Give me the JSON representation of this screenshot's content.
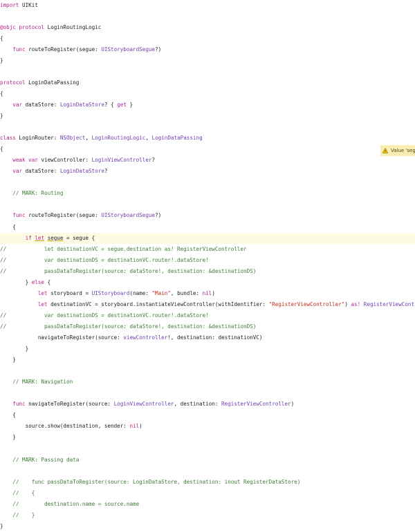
{
  "colors": {
    "background": "#ffffff",
    "keyword": "#b0238f",
    "type": "#6e3fb0",
    "comment": "#3f7d36",
    "string": "#c42a1b",
    "plain": "#1d1d1d",
    "current_line_highlight": "#fdfbe3",
    "warning_badge": "#f7edb5"
  },
  "warning": {
    "icon": "warning-triangle-icon",
    "text": "Value 'seg"
  },
  "code_lines": [
    [
      [
        "k",
        "import"
      ],
      [
        "p",
        " UIKit"
      ]
    ],
    [],
    [
      [
        "k",
        "@objc protocol"
      ],
      [
        "p",
        " LoginRoutingLogic"
      ]
    ],
    [
      [
        "p",
        "{"
      ]
    ],
    [
      [
        "k",
        "    func"
      ],
      [
        "p",
        " routeToRegister(segue: "
      ],
      [
        "t",
        "UIStoryboardSegue"
      ],
      [
        "p",
        "?)"
      ]
    ],
    [
      [
        "p",
        "}"
      ]
    ],
    [],
    [
      [
        "k",
        "protocol"
      ],
      [
        "p",
        " LoginDataPassing"
      ]
    ],
    [
      [
        "p",
        "{"
      ]
    ],
    [
      [
        "k",
        "    var"
      ],
      [
        "p",
        " dataStore: "
      ],
      [
        "t",
        "LoginDataStore"
      ],
      [
        "p",
        "? { "
      ],
      [
        "k",
        "get"
      ],
      [
        "p",
        " }"
      ]
    ],
    [
      [
        "p",
        "}"
      ]
    ],
    [],
    [
      [
        "k",
        "class"
      ],
      [
        "p",
        " LoginRouter: "
      ],
      [
        "t",
        "NSObject"
      ],
      [
        "p",
        ", "
      ],
      [
        "t",
        "LoginRoutingLogic"
      ],
      [
        "p",
        ", "
      ],
      [
        "t",
        "LoginDataPassing"
      ]
    ],
    [
      [
        "p",
        "{"
      ]
    ],
    [
      [
        "k",
        "    weak var"
      ],
      [
        "p",
        " viewController: "
      ],
      [
        "t",
        "LoginViewController"
      ],
      [
        "p",
        "?"
      ]
    ],
    [
      [
        "k",
        "    var"
      ],
      [
        "p",
        " dataStore: "
      ],
      [
        "t",
        "LoginDataStore"
      ],
      [
        "p",
        "?"
      ]
    ],
    [],
    [
      [
        "c",
        "    // MARK: Routing"
      ]
    ],
    [],
    [
      [
        "k",
        "    func"
      ],
      [
        "p",
        " routeToRegister(segue: "
      ],
      [
        "t",
        "UIStoryboardSegue"
      ],
      [
        "p",
        "?)"
      ]
    ],
    [
      [
        "p",
        "    {"
      ]
    ],
    [
      [
        "k",
        "        if "
      ],
      [
        "ku",
        "let"
      ],
      [
        "p",
        " "
      ],
      [
        "pu",
        "segue"
      ],
      [
        "p",
        " = segue {"
      ]
    ],
    [
      [
        "c",
        "//            let destinationVC = segue.destination as! RegisterViewController"
      ]
    ],
    [
      [
        "c",
        "//            var destinationDS = destinationVC.router!.dataStore!"
      ]
    ],
    [
      [
        "c",
        "//            passDataToRegister(source: dataStore!, destination: &destinationDS)"
      ]
    ],
    [
      [
        "p",
        "        } "
      ],
      [
        "k",
        "else"
      ],
      [
        "p",
        " {"
      ]
    ],
    [
      [
        "k",
        "            let"
      ],
      [
        "p",
        " storyboard = "
      ],
      [
        "t",
        "UIStoryboard"
      ],
      [
        "p",
        "(name: "
      ],
      [
        "s",
        "\"Main\""
      ],
      [
        "p",
        ", bundle: "
      ],
      [
        "k",
        "nil"
      ],
      [
        "p",
        ")"
      ]
    ],
    [
      [
        "k",
        "            let"
      ],
      [
        "p",
        " destinationVC = storyboard.instantiateViewController(withIdentifier: "
      ],
      [
        "s",
        "\"RegisterViewController\""
      ],
      [
        "p",
        ") "
      ],
      [
        "k",
        "as!"
      ],
      [
        "p",
        " "
      ],
      [
        "t",
        "RegisterViewController"
      ]
    ],
    [
      [
        "c",
        "//            var destinationDS = destinationVC.router!.dataStore!"
      ]
    ],
    [
      [
        "c",
        "//            passDataToRegister(source: dataStore!, destination: &destinationDS)"
      ]
    ],
    [
      [
        "p",
        "            navigateToRegister(source: "
      ],
      [
        "t",
        "viewController"
      ],
      [
        "p",
        "!, destination: destinationVC)"
      ]
    ],
    [
      [
        "p",
        "        }"
      ]
    ],
    [
      [
        "p",
        "    }"
      ]
    ],
    [],
    [
      [
        "c",
        "    // MARK: Navigation"
      ]
    ],
    [],
    [
      [
        "k",
        "    func"
      ],
      [
        "p",
        " navigateToRegister(source: "
      ],
      [
        "t",
        "LoginViewController"
      ],
      [
        "p",
        ", destination: "
      ],
      [
        "t",
        "RegisterViewController"
      ],
      [
        "p",
        ")"
      ]
    ],
    [
      [
        "p",
        "    {"
      ]
    ],
    [
      [
        "p",
        "        source.show(destination, sender: "
      ],
      [
        "k",
        "nil"
      ],
      [
        "p",
        ")"
      ]
    ],
    [
      [
        "p",
        "    }"
      ]
    ],
    [],
    [
      [
        "c",
        "    // MARK: Passing data"
      ]
    ],
    [],
    [
      [
        "c",
        "    //    func passDataToRegister(source: LoginDataStore, destination: inout RegisterDataStore)"
      ]
    ],
    [
      [
        "c",
        "    //    {"
      ]
    ],
    [
      [
        "c",
        "    //        destination.name = source.name"
      ]
    ],
    [
      [
        "c",
        "    //    }"
      ]
    ],
    [
      [
        "p",
        "}"
      ]
    ]
  ]
}
